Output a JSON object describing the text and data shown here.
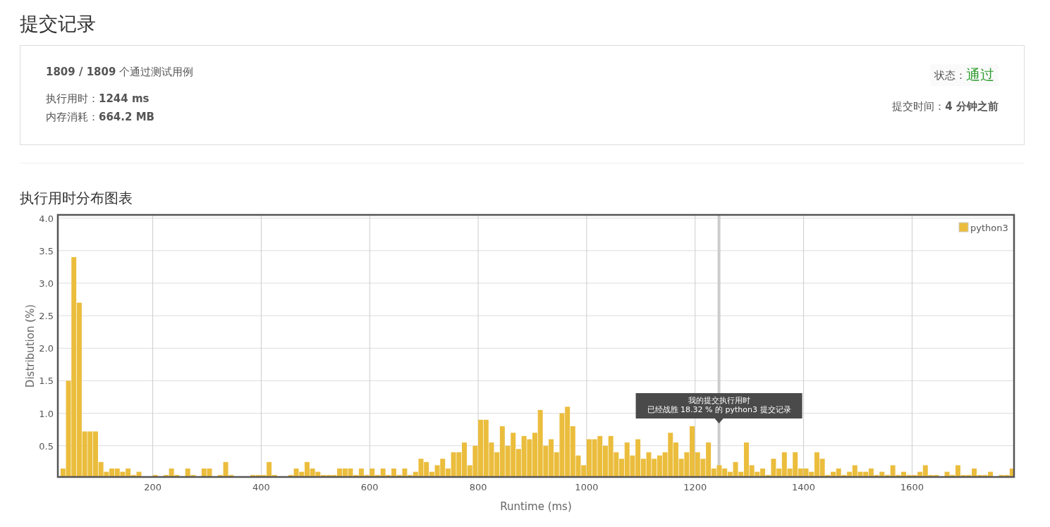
{
  "page_title": "提交记录",
  "summary": {
    "cases": "**1809 / 1809** 个通过测试用例",
    "runtime": "执行用时：**1244 ms**",
    "memory": "内存消耗：**664.2 MB**",
    "status_label": "状态：",
    "status": "通过",
    "submitted": "提交时间：**4 分钟之前**"
  },
  "section_title": "执行用时分布图表",
  "chart": {
    "chart_data": {
      "type": "bar",
      "xlabel": "Runtime (ms)",
      "ylabel": "Distribution (%)",
      "x": [
        30,
        40,
        50,
        60,
        70,
        80,
        90,
        100,
        110,
        120,
        130,
        140,
        150,
        160,
        170,
        200,
        220,
        230,
        240,
        260,
        270,
        290,
        300,
        320,
        330,
        340,
        380,
        390,
        400,
        410,
        420,
        450,
        460,
        470,
        480,
        490,
        500,
        510,
        520,
        530,
        540,
        550,
        560,
        570,
        580,
        590,
        600,
        610,
        620,
        630,
        640,
        650,
        660,
        670,
        680,
        690,
        700,
        710,
        720,
        730,
        740,
        750,
        760,
        770,
        780,
        790,
        800,
        810,
        820,
        830,
        840,
        850,
        860,
        870,
        880,
        890,
        900,
        910,
        920,
        930,
        940,
        950,
        960,
        970,
        980,
        990,
        1000,
        1010,
        1020,
        1030,
        1040,
        1050,
        1060,
        1070,
        1080,
        1090,
        1100,
        1110,
        1120,
        1130,
        1140,
        1150,
        1160,
        1170,
        1180,
        1190,
        1200,
        1210,
        1220,
        1230,
        1240,
        1250,
        1260,
        1270,
        1280,
        1290,
        1300,
        1310,
        1320,
        1330,
        1340,
        1350,
        1360,
        1370,
        1380,
        1390,
        1400,
        1410,
        1420,
        1430,
        1440,
        1450,
        1460,
        1470,
        1480,
        1490,
        1500,
        1510,
        1520,
        1530,
        1540,
        1550,
        1560,
        1570,
        1580,
        1590,
        1600,
        1610,
        1620,
        1630,
        1640,
        1660,
        1670,
        1680,
        1690,
        1700,
        1710,
        1720,
        1730,
        1740,
        1760,
        1770,
        1780
      ],
      "series": [
        {
          "name": "python3",
          "color": "#ebbd3d",
          "values": [
            0.15,
            1.5,
            3.4,
            2.7,
            0.72,
            0.72,
            0.72,
            0.25,
            0.1,
            0.15,
            0.15,
            0.1,
            0.15,
            0.05,
            0.1,
            0.05,
            0.05,
            0.15,
            0.05,
            0.15,
            0.05,
            0.15,
            0.15,
            0.05,
            0.25,
            0.05,
            0.05,
            0.05,
            0.05,
            0.25,
            0.05,
            0.05,
            0.15,
            0.1,
            0.25,
            0.15,
            0.1,
            0.05,
            0.05,
            0.05,
            0.15,
            0.15,
            0.15,
            0.05,
            0.15,
            0.05,
            0.15,
            0.05,
            0.15,
            0.05,
            0.15,
            0.05,
            0.15,
            0.05,
            0.1,
            0.3,
            0.25,
            0.1,
            0.2,
            0.3,
            0.15,
            0.4,
            0.4,
            0.55,
            0.2,
            0.5,
            0.9,
            0.9,
            0.55,
            0.4,
            0.8,
            0.5,
            0.7,
            0.45,
            0.65,
            0.6,
            0.7,
            1.05,
            0.5,
            0.6,
            0.4,
            1.0,
            1.1,
            0.8,
            0.35,
            0.2,
            0.6,
            0.6,
            0.65,
            0.5,
            0.65,
            0.4,
            0.3,
            0.55,
            0.35,
            0.6,
            0.3,
            0.4,
            0.3,
            0.35,
            0.4,
            0.7,
            0.55,
            0.3,
            0.4,
            0.8,
            0.4,
            0.3,
            0.55,
            0.15,
            0.2,
            0.15,
            0.1,
            0.25,
            0.1,
            0.55,
            0.2,
            0.1,
            0.15,
            0.05,
            0.3,
            0.15,
            0.4,
            0.15,
            0.4,
            0.15,
            0.15,
            0.1,
            0.4,
            0.3,
            0.05,
            0.1,
            0.15,
            0.05,
            0.1,
            0.2,
            0.1,
            0.1,
            0.15,
            0.05,
            0.1,
            0.05,
            0.2,
            0.05,
            0.1,
            0.05,
            0.05,
            0.1,
            0.2,
            0.05,
            0.05,
            0.1,
            0.05,
            0.2,
            0.05,
            0.05,
            0.15,
            0.05,
            0.05,
            0.1,
            0.05,
            0.05,
            0.15
          ]
        }
      ],
      "xlim": [
        25,
        1788
      ],
      "ylim": [
        0.02,
        4.05
      ],
      "xticks": [
        200,
        400,
        600,
        800,
        1000,
        1200,
        1400,
        1600
      ],
      "yticks": [
        {
          "value": 0.5,
          "label": "0.5"
        },
        {
          "value": 1,
          "label": "1.0"
        },
        {
          "value": 1.5,
          "label": "1.5"
        },
        {
          "value": 2,
          "label": "2.0"
        },
        {
          "value": 2.5,
          "label": "2.5"
        },
        {
          "value": 3,
          "label": "3.0"
        },
        {
          "value": 3.5,
          "label": "3.5"
        },
        {
          "value": 4,
          "label": "4.0"
        }
      ],
      "grid": true,
      "ref_lines": [
        {
          "axis": "x",
          "value": 1244
        }
      ]
    },
    "tooltip": {
      "lines": [
        "我的提交执行用时",
        "已经战胜 18.32 % 的 python3 提交记录"
      ]
    }
  }
}
